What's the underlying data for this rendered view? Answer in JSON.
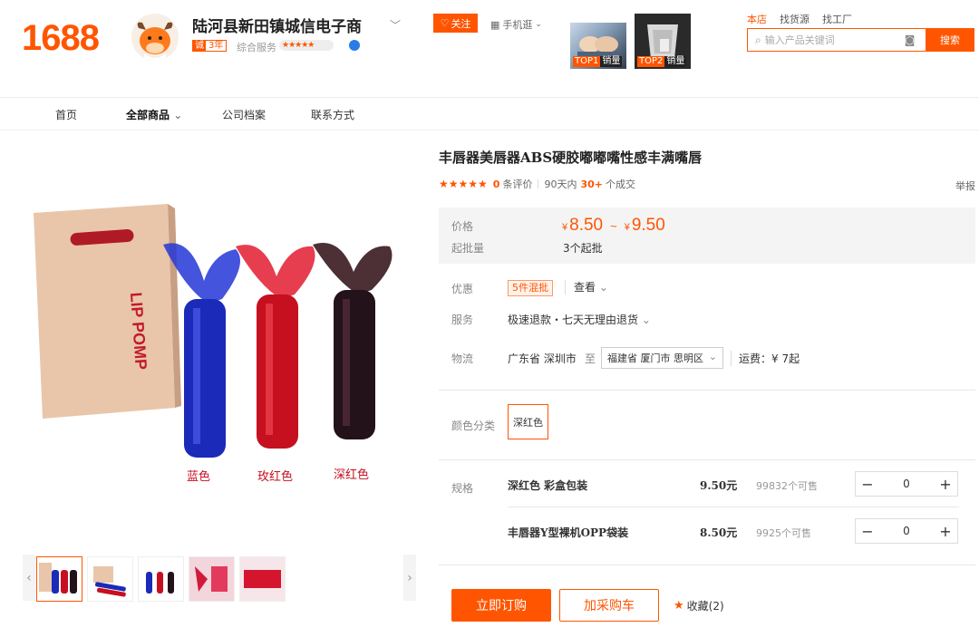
{
  "header": {
    "logo": "1688",
    "shop_name": "陆河县新田镇城信电子商",
    "years_badge_prefix": "诚",
    "years_badge": "3年",
    "service_label": "综合服务",
    "service_stars": "★★★★★",
    "follow_label": "关注",
    "mobile_label": "手机逛",
    "top_products": [
      {
        "rank": "TOP1",
        "sold_label": "销量"
      },
      {
        "rank": "TOP2",
        "sold_label": "销量"
      }
    ],
    "search_tabs": [
      "本店",
      "找货源",
      "找工厂"
    ],
    "search_placeholder": "输入产品关键词",
    "search_button": "搜索"
  },
  "nav": {
    "items": [
      "首页",
      "全部商品",
      "公司档案",
      "联系方式"
    ]
  },
  "gallery": {
    "box_text": "LIP POMP",
    "color_labels": [
      "蓝色",
      "玫红色",
      "深红色"
    ],
    "colors": {
      "blue": "#1f2fc4",
      "rose": "#d0102a",
      "deep": "#2a1820",
      "box": "#e9c6aa"
    }
  },
  "product": {
    "title": "丰唇器美唇器ABS硬胶嘟嘟嘴性感丰满嘴唇",
    "stars": "★★★★★",
    "review_count": "0",
    "review_label": "条评价",
    "period_label": "90天内",
    "deal_count": "30+",
    "deal_label": "个成交",
    "report_label": "举报",
    "price_label": "价格",
    "currency": "¥",
    "price_low": "8.50",
    "price_high": "9.50",
    "price_sep": "~",
    "moq_label": "起批量",
    "moq_value": "3个起批",
    "promo_label": "优惠",
    "promo_tag": "5件混批",
    "promo_view": "查看",
    "service_label": "服务",
    "service_value": "极速退款・七天无理由退货",
    "logistics_label": "物流",
    "ship_from": "广东省 深圳市",
    "ship_to_label": "至",
    "ship_to": "福建省 厦门市 思明区",
    "freight": "运费：¥ 7起",
    "color_label": "颜色分类",
    "color_option": "深红色",
    "spec_label": "规格",
    "specs": [
      {
        "name": "深红色 彩盒包装",
        "price": "9.50元",
        "stock": "99832个可售",
        "qty": "0"
      },
      {
        "name": "丰唇器Y型裸机OPP袋装",
        "price": "8.50元",
        "stock": "9925个可售",
        "qty": "0"
      }
    ],
    "buy_now": "立即订购",
    "add_cart": "加采购车",
    "favorite": "收藏(2)"
  },
  "accent_color": "#ff5500"
}
